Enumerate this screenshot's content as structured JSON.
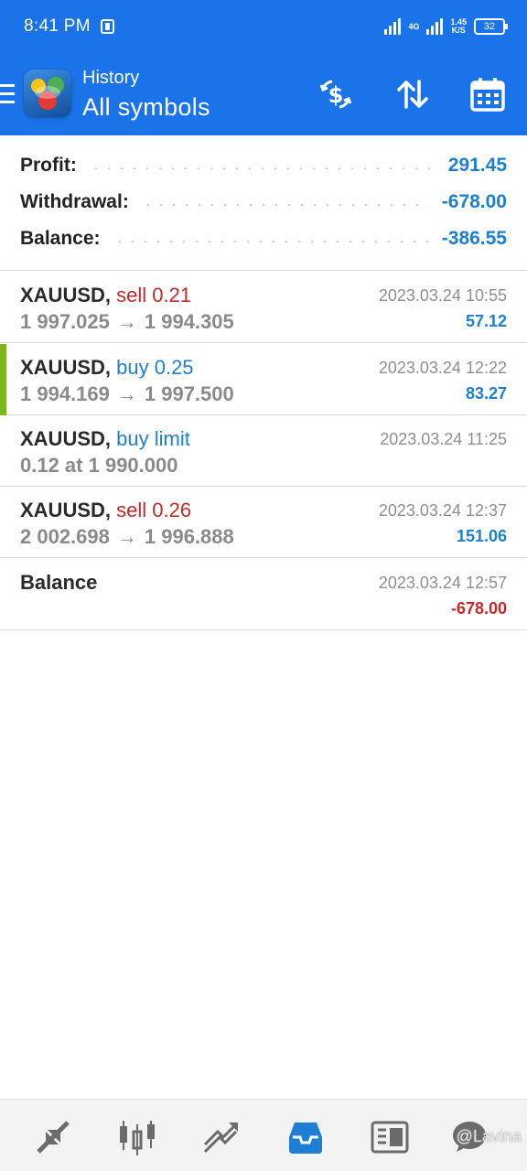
{
  "status_bar": {
    "time": "8:41 PM",
    "network": "4G",
    "speed_value": "1.45",
    "speed_unit": "K/S",
    "battery": "32"
  },
  "header": {
    "subtitle": "History",
    "title": "All symbols",
    "icons": [
      "menu-icon",
      "app-logo",
      "deposit-icon",
      "sort-icon",
      "calendar-icon"
    ]
  },
  "summary": {
    "profit_label": "Profit:",
    "profit_value": "291.45",
    "withdrawal_label": "Withdrawal:",
    "withdrawal_value": "-678.00",
    "balance_label": "Balance:",
    "balance_value": "-386.55"
  },
  "deals": [
    {
      "symbol": "XAUUSD,",
      "action": "sell 0.21",
      "prices_open": "1 997.025",
      "arrow": "→",
      "prices_close": "1 994.305",
      "time": "2023.03.24 10:55",
      "pnl": "57.12"
    },
    {
      "symbol": "XAUUSD,",
      "action": "buy 0.25",
      "prices_open": "1 994.169",
      "arrow": "→",
      "prices_close": "1 997.500",
      "time": "2023.03.24 12:22",
      "pnl": "83.27"
    },
    {
      "symbol": "XAUUSD,",
      "action": "buy limit",
      "detail": "0.12 at 1 990.000",
      "time": "2023.03.24 11:25"
    },
    {
      "symbol": "XAUUSD,",
      "action": "sell 0.26",
      "prices_open": "2 002.698",
      "arrow": "→",
      "prices_close": "1 996.888",
      "time": "2023.03.24 12:37",
      "pnl": "151.06"
    },
    {
      "symbol": "Balance",
      "time": "2023.03.24 12:57",
      "pnl": "-678.00"
    }
  ],
  "bottom_nav": {
    "items": [
      "quotes-icon",
      "chart-icon",
      "trade-icon",
      "history-icon",
      "news-icon",
      "chat-icon"
    ],
    "active": "history-icon",
    "watermark": "@Lavina"
  },
  "colors": {
    "brand": "#1a73e8",
    "positive": "#1c7fd3",
    "negative": "#c62828",
    "open_marker": "#7cb518"
  }
}
